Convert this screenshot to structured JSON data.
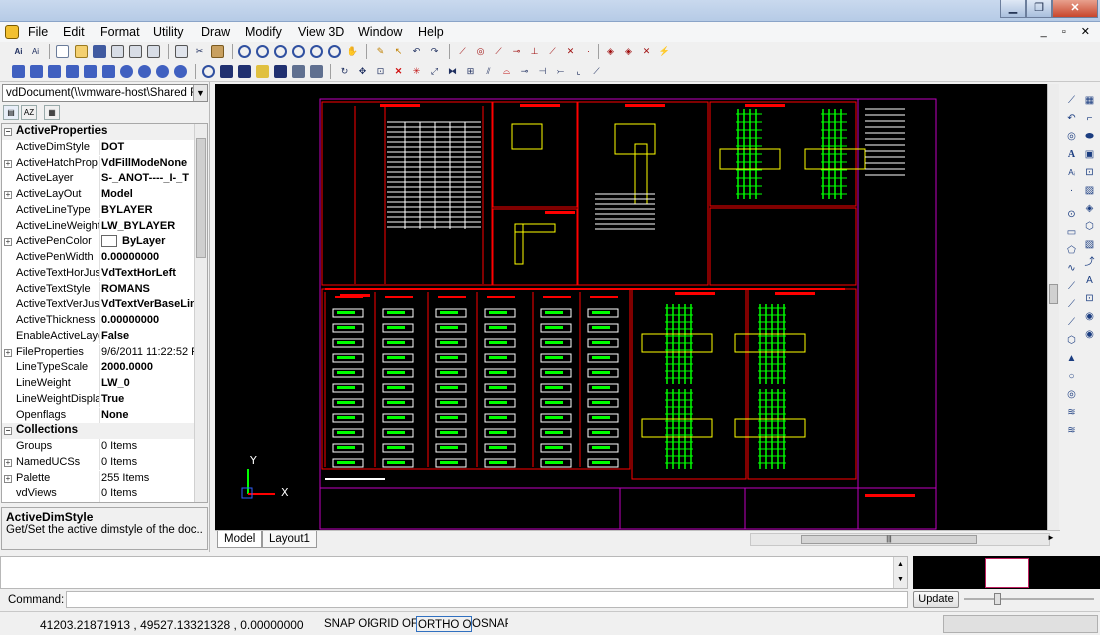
{
  "menu": {
    "items": [
      "File",
      "Edit",
      "Format",
      "Utility",
      "Draw",
      "Modify",
      "View 3D",
      "Window",
      "Help"
    ],
    "mdi_controls": "_ ▫ ✕"
  },
  "window_controls": {
    "minimize": "▁",
    "maximize": "❐",
    "close": "✕"
  },
  "toolbar1": {
    "text_buttons": [
      "Ai",
      "Ai"
    ]
  },
  "left_panel": {
    "document_selector": "vdDocument(\\\\vmware-host\\Shared Fol",
    "properties": [
      {
        "name": "ActiveProperties",
        "value": "",
        "category": true
      },
      {
        "name": "ActiveDimStyle",
        "value": "DOT"
      },
      {
        "name": "ActiveHatchProp",
        "value": "VdFillModeNone",
        "expandable": true
      },
      {
        "name": "ActiveLayer",
        "value": "S-_ANOT----_I-_T"
      },
      {
        "name": "ActiveLayOut",
        "value": "Model",
        "expandable": true
      },
      {
        "name": "ActiveLineType",
        "value": "BYLAYER"
      },
      {
        "name": "ActiveLineWeight",
        "value": "LW_BYLAYER"
      },
      {
        "name": "ActivePenColor",
        "value": "ByLayer",
        "expandable": true,
        "swatch": true
      },
      {
        "name": "ActivePenWidth",
        "value": "0.00000000"
      },
      {
        "name": "ActiveTextHorJus",
        "value": "VdTextHorLeft"
      },
      {
        "name": "ActiveTextStyle",
        "value": "ROMANS"
      },
      {
        "name": "ActiveTextVerJus",
        "value": "VdTextVerBaseLin"
      },
      {
        "name": "ActiveThickness",
        "value": "0.00000000"
      },
      {
        "name": "EnableActiveLaye",
        "value": "False"
      },
      {
        "name": "FileProperties",
        "value": "9/6/2011 11:22:52 F",
        "expandable": true,
        "light": true
      },
      {
        "name": "LineTypeScale",
        "value": "2000.0000"
      },
      {
        "name": "LineWeight",
        "value": "LW_0"
      },
      {
        "name": "LineWeightDispla",
        "value": "True"
      },
      {
        "name": "Openflags",
        "value": "None"
      },
      {
        "name": "Collections",
        "value": "",
        "category": true
      },
      {
        "name": "Groups",
        "value": "0 Items",
        "light": true
      },
      {
        "name": "NamedUCSs",
        "value": "0 Items",
        "expandable": true,
        "light": true
      },
      {
        "name": "Palette",
        "value": "255 Items",
        "expandable": true,
        "light": true
      },
      {
        "name": "vdViews",
        "value": "0 Items",
        "light": true
      }
    ],
    "description": {
      "title": "ActiveDimStyle",
      "text": "Get/Set the active dimstyle of the doc..."
    }
  },
  "canvas": {
    "axis_labels": {
      "y": "Y",
      "x": "X"
    },
    "colors": {
      "background": "#000000",
      "frame": "#c000c0",
      "detail": "#ff0000",
      "rebar": "#00ff00",
      "concrete": "#ffff00",
      "text": "#ffffff"
    }
  },
  "layout_tabs": [
    "Model",
    "Layout1"
  ],
  "command": {
    "label": "Command:",
    "value": ""
  },
  "update_button": "Update",
  "status": {
    "coordinates": "41203.21871913 , 49527.13321328 , 0.00000000",
    "toggles": [
      "SNAP OFF",
      "GRID OFF",
      "ORTHO ON",
      "OSNAP"
    ]
  }
}
